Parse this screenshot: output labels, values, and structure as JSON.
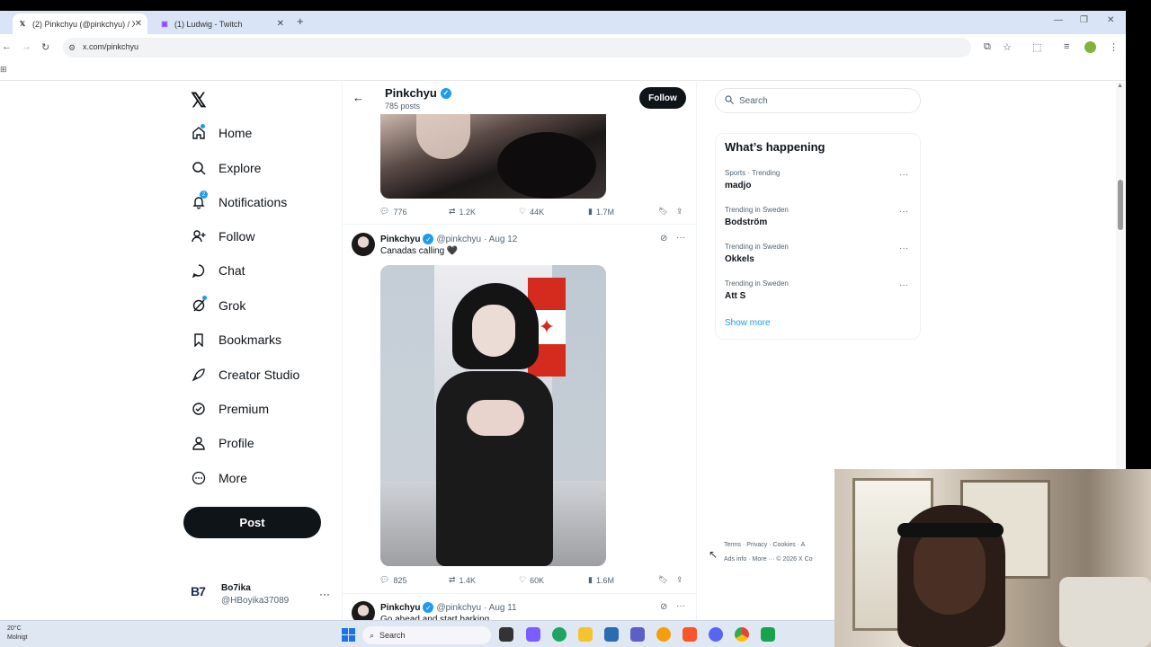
{
  "browser": {
    "tabs": [
      {
        "title": "(2) Pinkchyu (@pinkchyu) / X",
        "active": true
      },
      {
        "title": "(1) Ludwig - Twitch",
        "active": false
      }
    ],
    "url": "x.com/pinkchyu"
  },
  "nav": {
    "items": [
      {
        "label": "Home",
        "icon": "home-icon"
      },
      {
        "label": "Explore",
        "icon": "search-icon"
      },
      {
        "label": "Notifications",
        "icon": "bell-icon",
        "badge": "2"
      },
      {
        "label": "Follow",
        "icon": "person-plus-icon"
      },
      {
        "label": "Chat",
        "icon": "chat-bubble-icon"
      },
      {
        "label": "Grok",
        "icon": "grok-icon"
      },
      {
        "label": "Bookmarks",
        "icon": "bookmark-icon"
      },
      {
        "label": "Creator Studio",
        "icon": "rocket-icon"
      },
      {
        "label": "Premium",
        "icon": "verified-icon"
      },
      {
        "label": "Profile",
        "icon": "person-icon"
      },
      {
        "label": "More",
        "icon": "more-circle-icon"
      }
    ],
    "post_label": "Post",
    "user": {
      "name": "Bo7ika",
      "handle": "@HBoyika37089",
      "avatar_text": "B7"
    }
  },
  "profile": {
    "name": "Pinkchyu",
    "posts": "785 posts",
    "follow_label": "Follow"
  },
  "tweets": [
    {
      "replies": "776",
      "reposts": "1.2K",
      "likes": "44K",
      "views": "1.7M"
    },
    {
      "author": "Pinkchyu",
      "handle": "@pinkchyu",
      "date": "· Aug 12",
      "text": "Canadas calling 🖤",
      "replies": "825",
      "reposts": "1.4K",
      "likes": "60K",
      "views": "1.6M"
    },
    {
      "author": "Pinkchyu",
      "handle": "@pinkchyu",
      "date": "· Aug 11",
      "text": "Go ahead and start barking"
    }
  ],
  "sidebar": {
    "search_placeholder": "Search",
    "title": "What’s happening",
    "trends": [
      {
        "meta": "Sports · Trending",
        "name": "madjo"
      },
      {
        "meta": "Trending in Sweden",
        "name": "Bodström"
      },
      {
        "meta": "Trending in Sweden",
        "name": "Okkels"
      },
      {
        "meta": "Trending in Sweden",
        "name": "Att S"
      }
    ],
    "show_more": "Show more",
    "footer_line1": "Terms · Privacy · Cookies · A",
    "footer_line2": "Ads info · More ··· © 2026 X Co"
  },
  "taskbar": {
    "weather_temp": "20°C",
    "weather_desc": "Molnigt",
    "search_label": "Search"
  },
  "colors": {
    "accent": "#1d9bf0",
    "text": "#0f1419",
    "muted": "#536471"
  }
}
